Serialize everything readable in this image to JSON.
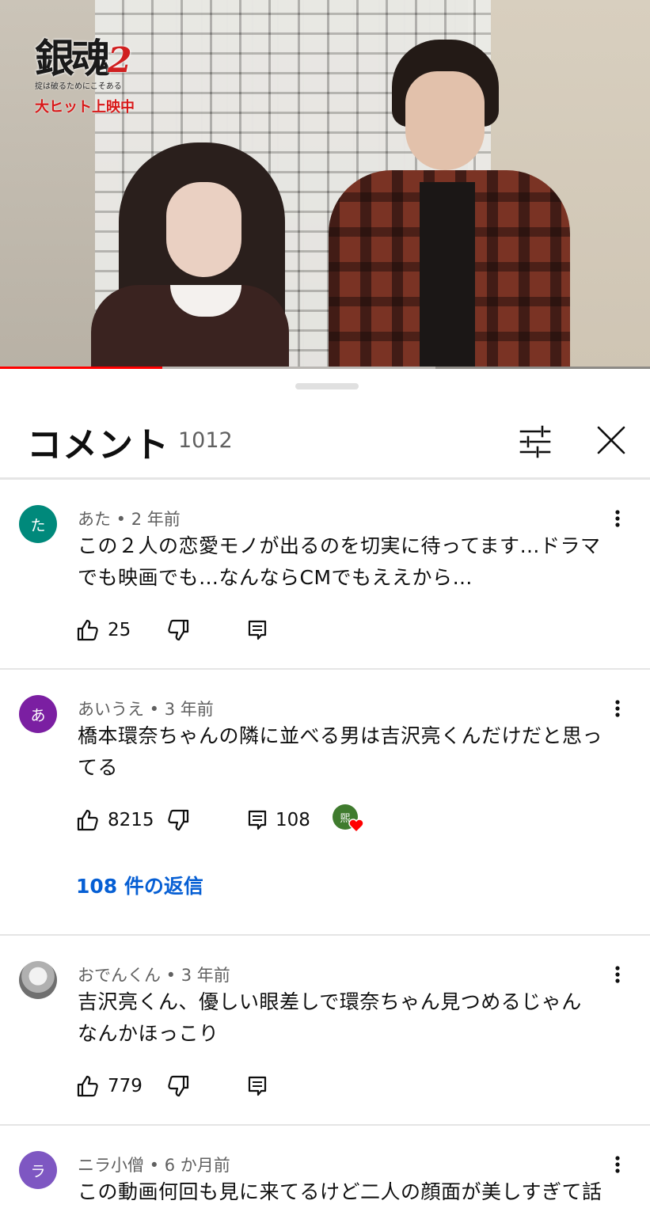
{
  "video": {
    "logo_title": "銀魂",
    "logo_number": "2",
    "logo_tagline": "掟は破るためにこそある",
    "logo_status": "大ヒット上映中",
    "progress_fraction": 0.25,
    "buffer_fraction": 0.67
  },
  "sheet": {
    "title": "コメント",
    "count": "1012",
    "filter_icon": "sliders-icon",
    "close_icon": "close-icon"
  },
  "comments": [
    {
      "avatar_letter": "た",
      "avatar_color": "#00897b",
      "author": "あた",
      "time": "2 年前",
      "text_line1": "この２人の恋愛モノが出るのを切実に待ってます…ドラマ",
      "text_line2": "でも映画でも…なんならCMでもええから…",
      "likes": "25"
    },
    {
      "avatar_letter": "あ",
      "avatar_color": "#7b1fa2",
      "author": "あいうえ",
      "time": "3 年前",
      "text_line1": "橋本環奈ちゃんの隣に並べる男は吉沢亮くんだけだと思っ",
      "text_line2": "てる",
      "likes": "8215",
      "reply_count": "108",
      "creator_badge_letter": "煕",
      "replies_link": "108 件の返信"
    },
    {
      "avatar_letter": "",
      "avatar_color": "#9e9e9e",
      "author": "おでんくん",
      "time": "3 年前",
      "text_line1": "吉沢亮くん、優しい眼差しで環奈ちゃん見つめるじゃん",
      "text_line2": "なんかほっこり",
      "likes": "779"
    },
    {
      "avatar_letter": "ラ",
      "avatar_color": "#7e57c2",
      "author": "ニラ小僧",
      "time": "6 か月前",
      "text_line1": "この動画何回も見に来てるけど二人の顔面が美しすぎて話"
    }
  ],
  "separator": " • "
}
